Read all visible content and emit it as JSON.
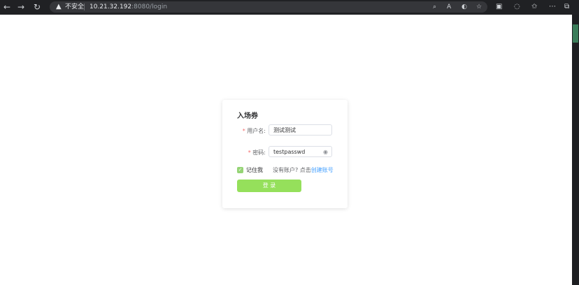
{
  "browser": {
    "security_label": "不安全",
    "url_host": "10.21.32.192",
    "url_path": ":8080/login",
    "icons": [
      "back-icon",
      "forward-icon",
      "refresh-icon",
      "search-icon",
      "read-aloud-icon",
      "edge-icon",
      "favorite-icon",
      "collections-icon",
      "extensions-icon",
      "favorites-bar-icon",
      "more-icon",
      "sidebar-icon"
    ]
  },
  "login": {
    "title": "入场券",
    "username_label": "用户名:",
    "username_value": "测试测试",
    "password_label": "密码:",
    "password_value": "testpasswd",
    "required_mark": "*",
    "remember_label": "记住我",
    "remember_checked": true,
    "no_account_text": "没有账户? 点击",
    "create_account_link": "创建账号",
    "login_button": "登 录"
  },
  "colors": {
    "accent_green": "#95e05b",
    "link_blue": "#409eff",
    "required_red": "#f56c6c"
  }
}
